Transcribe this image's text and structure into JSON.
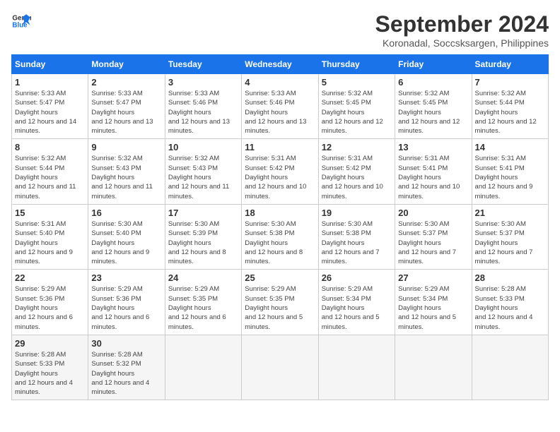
{
  "header": {
    "logo_line1": "General",
    "logo_line2": "Blue",
    "month": "September 2024",
    "location": "Koronadal, Soccsksargen, Philippines"
  },
  "weekdays": [
    "Sunday",
    "Monday",
    "Tuesday",
    "Wednesday",
    "Thursday",
    "Friday",
    "Saturday"
  ],
  "weeks": [
    [
      {
        "day": "1",
        "rise": "5:33 AM",
        "set": "5:47 PM",
        "daylight": "12 hours and 14 minutes."
      },
      {
        "day": "2",
        "rise": "5:33 AM",
        "set": "5:47 PM",
        "daylight": "12 hours and 13 minutes."
      },
      {
        "day": "3",
        "rise": "5:33 AM",
        "set": "5:46 PM",
        "daylight": "12 hours and 13 minutes."
      },
      {
        "day": "4",
        "rise": "5:33 AM",
        "set": "5:46 PM",
        "daylight": "12 hours and 13 minutes."
      },
      {
        "day": "5",
        "rise": "5:32 AM",
        "set": "5:45 PM",
        "daylight": "12 hours and 12 minutes."
      },
      {
        "day": "6",
        "rise": "5:32 AM",
        "set": "5:45 PM",
        "daylight": "12 hours and 12 minutes."
      },
      {
        "day": "7",
        "rise": "5:32 AM",
        "set": "5:44 PM",
        "daylight": "12 hours and 12 minutes."
      }
    ],
    [
      {
        "day": "8",
        "rise": "5:32 AM",
        "set": "5:44 PM",
        "daylight": "12 hours and 11 minutes."
      },
      {
        "day": "9",
        "rise": "5:32 AM",
        "set": "5:43 PM",
        "daylight": "12 hours and 11 minutes."
      },
      {
        "day": "10",
        "rise": "5:32 AM",
        "set": "5:43 PM",
        "daylight": "12 hours and 11 minutes."
      },
      {
        "day": "11",
        "rise": "5:31 AM",
        "set": "5:42 PM",
        "daylight": "12 hours and 10 minutes."
      },
      {
        "day": "12",
        "rise": "5:31 AM",
        "set": "5:42 PM",
        "daylight": "12 hours and 10 minutes."
      },
      {
        "day": "13",
        "rise": "5:31 AM",
        "set": "5:41 PM",
        "daylight": "12 hours and 10 minutes."
      },
      {
        "day": "14",
        "rise": "5:31 AM",
        "set": "5:41 PM",
        "daylight": "12 hours and 9 minutes."
      }
    ],
    [
      {
        "day": "15",
        "rise": "5:31 AM",
        "set": "5:40 PM",
        "daylight": "12 hours and 9 minutes."
      },
      {
        "day": "16",
        "rise": "5:30 AM",
        "set": "5:40 PM",
        "daylight": "12 hours and 9 minutes."
      },
      {
        "day": "17",
        "rise": "5:30 AM",
        "set": "5:39 PM",
        "daylight": "12 hours and 8 minutes."
      },
      {
        "day": "18",
        "rise": "5:30 AM",
        "set": "5:38 PM",
        "daylight": "12 hours and 8 minutes."
      },
      {
        "day": "19",
        "rise": "5:30 AM",
        "set": "5:38 PM",
        "daylight": "12 hours and 7 minutes."
      },
      {
        "day": "20",
        "rise": "5:30 AM",
        "set": "5:37 PM",
        "daylight": "12 hours and 7 minutes."
      },
      {
        "day": "21",
        "rise": "5:30 AM",
        "set": "5:37 PM",
        "daylight": "12 hours and 7 minutes."
      }
    ],
    [
      {
        "day": "22",
        "rise": "5:29 AM",
        "set": "5:36 PM",
        "daylight": "12 hours and 6 minutes."
      },
      {
        "day": "23",
        "rise": "5:29 AM",
        "set": "5:36 PM",
        "daylight": "12 hours and 6 minutes."
      },
      {
        "day": "24",
        "rise": "5:29 AM",
        "set": "5:35 PM",
        "daylight": "12 hours and 6 minutes."
      },
      {
        "day": "25",
        "rise": "5:29 AM",
        "set": "5:35 PM",
        "daylight": "12 hours and 5 minutes."
      },
      {
        "day": "26",
        "rise": "5:29 AM",
        "set": "5:34 PM",
        "daylight": "12 hours and 5 minutes."
      },
      {
        "day": "27",
        "rise": "5:29 AM",
        "set": "5:34 PM",
        "daylight": "12 hours and 5 minutes."
      },
      {
        "day": "28",
        "rise": "5:28 AM",
        "set": "5:33 PM",
        "daylight": "12 hours and 4 minutes."
      }
    ],
    [
      {
        "day": "29",
        "rise": "5:28 AM",
        "set": "5:33 PM",
        "daylight": "12 hours and 4 minutes."
      },
      {
        "day": "30",
        "rise": "5:28 AM",
        "set": "5:32 PM",
        "daylight": "12 hours and 4 minutes."
      },
      {
        "day": "",
        "rise": "",
        "set": "",
        "daylight": ""
      },
      {
        "day": "",
        "rise": "",
        "set": "",
        "daylight": ""
      },
      {
        "day": "",
        "rise": "",
        "set": "",
        "daylight": ""
      },
      {
        "day": "",
        "rise": "",
        "set": "",
        "daylight": ""
      },
      {
        "day": "",
        "rise": "",
        "set": "",
        "daylight": ""
      }
    ]
  ]
}
